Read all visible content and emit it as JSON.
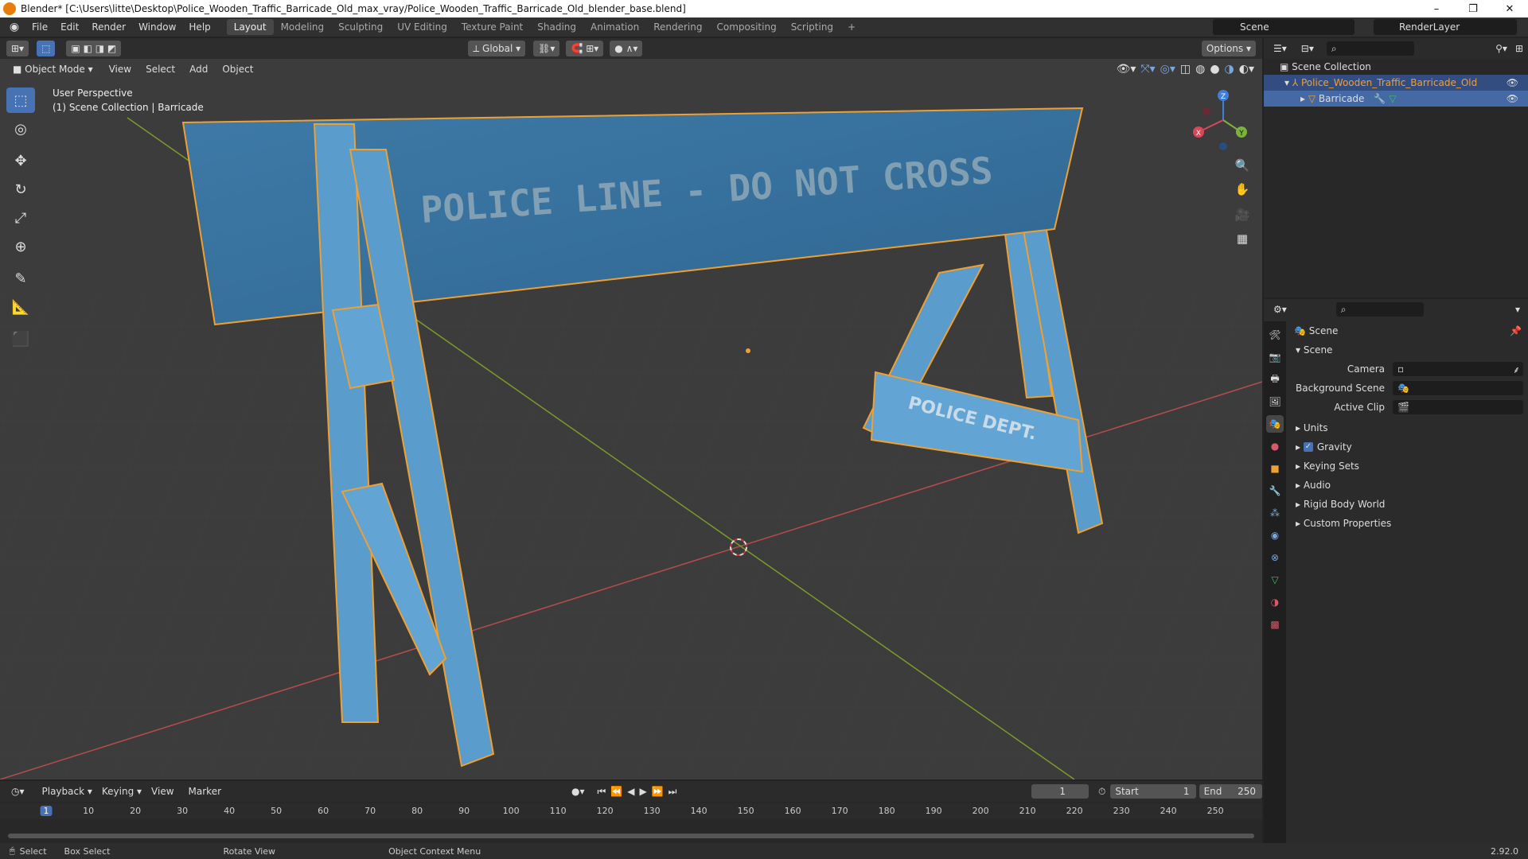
{
  "titlebar": {
    "title": "Blender* [C:\\Users\\litte\\Desktop\\Police_Wooden_Traffic_Barricade_Old_max_vray/Police_Wooden_Traffic_Barricade_Old_blender_base.blend]",
    "minimize": "–",
    "restore": "❐",
    "close": "✕"
  },
  "menu": [
    "File",
    "Edit",
    "Render",
    "Window",
    "Help"
  ],
  "workspaces": [
    "Layout",
    "Modeling",
    "Sculpting",
    "UV Editing",
    "Texture Paint",
    "Shading",
    "Animation",
    "Rendering",
    "Compositing",
    "Scripting"
  ],
  "workspace_add": "+",
  "scene_name": "Scene",
  "render_layer": "RenderLayer",
  "viewport": {
    "transform_orientation": "Global",
    "options_label": "Options",
    "mode": "Object Mode",
    "header_menus": [
      "View",
      "Select",
      "Add",
      "Object"
    ],
    "overlay_line1": "User Perspective",
    "overlay_line2": "(1) Scene Collection | Barricade",
    "gizmo_axes": {
      "x": "X",
      "y": "Y",
      "z": "Z"
    },
    "plank_text": "POLICE LINE - DO NOT CROSS",
    "crossbar_text": "POLICE DEPT."
  },
  "outliner": {
    "root": "Scene Collection",
    "items": [
      {
        "label": "Police_Wooden_Traffic_Barricade_Old"
      },
      {
        "label": "Barricade"
      }
    ]
  },
  "properties": {
    "context": "Scene",
    "section": "Scene",
    "fields": [
      {
        "label": "Camera",
        "value": ""
      },
      {
        "label": "Background Scene",
        "value": ""
      },
      {
        "label": "Active Clip",
        "value": ""
      }
    ],
    "panels": [
      "Units",
      "Gravity",
      "Keying Sets",
      "Audio",
      "Rigid Body World",
      "Custom Properties"
    ],
    "gravity_checked": true
  },
  "timeline": {
    "menus": [
      "Playback",
      "Keying",
      "View",
      "Marker"
    ],
    "current_frame": "1",
    "start_label": "Start",
    "start": "1",
    "end_label": "End",
    "end": "250",
    "ticks": [
      "1",
      "10",
      "20",
      "30",
      "40",
      "50",
      "60",
      "70",
      "80",
      "90",
      "100",
      "110",
      "120",
      "130",
      "140",
      "150",
      "160",
      "170",
      "180",
      "190",
      "200",
      "210",
      "220",
      "230",
      "240",
      "250"
    ]
  },
  "status": {
    "select": "Select",
    "box_select": "Box Select",
    "rotate": "Rotate View",
    "context_menu": "Object Context Menu",
    "version": "2.92.0"
  },
  "colors": {
    "accent": "#4772b3",
    "selection_outline": "#f0a030",
    "barricade_blue": "#4f8fc0",
    "axis_red": "#b84c4c",
    "axis_green": "#7a9a2a"
  }
}
